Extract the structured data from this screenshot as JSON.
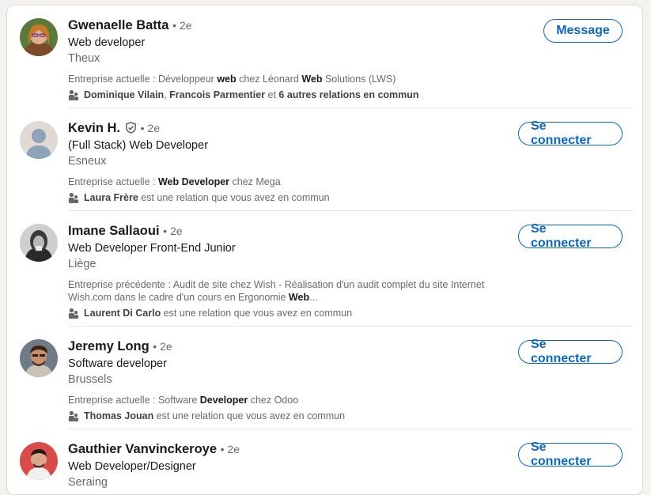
{
  "colors": {
    "accent": "#0a66c2",
    "card_bg": "#ffffff",
    "page_bg": "#f4f2ee"
  },
  "people": [
    {
      "name": "Gwenaelle Batta",
      "degree": "2e",
      "verified": false,
      "title": "Web developer",
      "location": "Theux",
      "company_prefix": "Entreprise actuelle",
      "company_parts": [
        "Développeur ",
        "web",
        " chez Léonard ",
        "Web",
        " Solutions (LWS)"
      ],
      "mutual_parts": [
        "Dominique Vilain",
        ", ",
        "Francois Parmentier",
        " et ",
        "6 autres relations en commun",
        ""
      ],
      "button": "Message"
    },
    {
      "name": "Kevin H.",
      "degree": "2e",
      "verified": true,
      "title": "(Full Stack) Web Developer",
      "location": "Esneux",
      "company_prefix": "Entreprise actuelle",
      "company_parts": [
        "",
        "Web Developer",
        " chez Mega"
      ],
      "mutual_parts": [
        "Laura Frère",
        " est une relation que vous avez en commun"
      ],
      "button": "Se connecter"
    },
    {
      "name": "Imane Sallaoui",
      "degree": "2e",
      "verified": false,
      "title": "Web Developer Front-End Junior",
      "location": "Liège",
      "company_prefix": "Entreprise précédente",
      "company_parts": [
        "Audit de site chez Wish - Réalisation d'un audit complet du site Internet Wish.com dans le cadre d'un cours en Ergonomie ",
        "Web",
        "..."
      ],
      "mutual_parts": [
        "Laurent Di Carlo",
        " est une relation que vous avez en commun"
      ],
      "button": "Se connecter"
    },
    {
      "name": "Jeremy Long",
      "degree": "2e",
      "verified": false,
      "title": "Software developer",
      "location": "Brussels",
      "company_prefix": "Entreprise actuelle",
      "company_parts": [
        "Software ",
        "Developer",
        " chez Odoo"
      ],
      "mutual_parts": [
        "Thomas Jouan",
        " est une relation que vous avez en commun"
      ],
      "button": "Se connecter"
    },
    {
      "name": "Gauthier Vanvinckeroye",
      "degree": "2e",
      "verified": false,
      "title": "Web Developer/Designer",
      "location": "Seraing",
      "company_prefix": "",
      "company_parts": [],
      "mutual_parts": [],
      "button": "Se connecter"
    }
  ]
}
